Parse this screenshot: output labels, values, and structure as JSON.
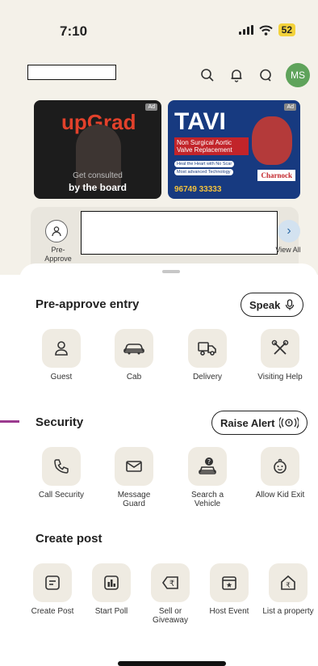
{
  "status_bar": {
    "time": "7:10",
    "battery": "52"
  },
  "header": {
    "avatar_initials": "MS",
    "icons": [
      "search-icon",
      "bell-icon",
      "chat-icon"
    ]
  },
  "ads": {
    "upgrad": {
      "brand": "upGrad",
      "line1": "Get consulted",
      "line2": "by the board",
      "tag": "Ad"
    },
    "tavi": {
      "brand": "TAVI",
      "subtitle": "Non Surgical Aortic Valve Replacement",
      "bullet1": "Heal the Heart with No Scar",
      "bullet2": "Most advanced Technology",
      "hospital": "Charnock",
      "phone": "96749 33333",
      "tag": "Ad"
    }
  },
  "shortcuts": {
    "pre_approve": "Pre-Approve",
    "view_all": "View All"
  },
  "sections": {
    "pre_approve": {
      "title": "Pre-approve entry",
      "action": "Speak",
      "items": [
        {
          "label": "Guest",
          "icon": "person-icon"
        },
        {
          "label": "Cab",
          "icon": "car-icon"
        },
        {
          "label": "Delivery",
          "icon": "delivery-truck-icon"
        },
        {
          "label": "Visiting Help",
          "icon": "tools-icon"
        }
      ]
    },
    "security": {
      "title": "Security",
      "action": "Raise Alert",
      "items": [
        {
          "label": "Call Security",
          "icon": "phone-icon"
        },
        {
          "label": "Message Guard",
          "icon": "mail-icon"
        },
        {
          "label": "Search a Vehicle",
          "icon": "vehicle-search-icon"
        },
        {
          "label": "Allow Kid Exit",
          "icon": "kid-icon"
        }
      ]
    },
    "create_post": {
      "title": "Create post",
      "items": [
        {
          "label": "Create Post",
          "icon": "post-icon"
        },
        {
          "label": "Start Poll",
          "icon": "poll-icon"
        },
        {
          "label": "Sell or Giveaway",
          "icon": "rupee-tag-icon"
        },
        {
          "label": "Host Event",
          "icon": "calendar-event-icon"
        },
        {
          "label": "List a property",
          "icon": "house-rupee-icon"
        }
      ]
    }
  }
}
